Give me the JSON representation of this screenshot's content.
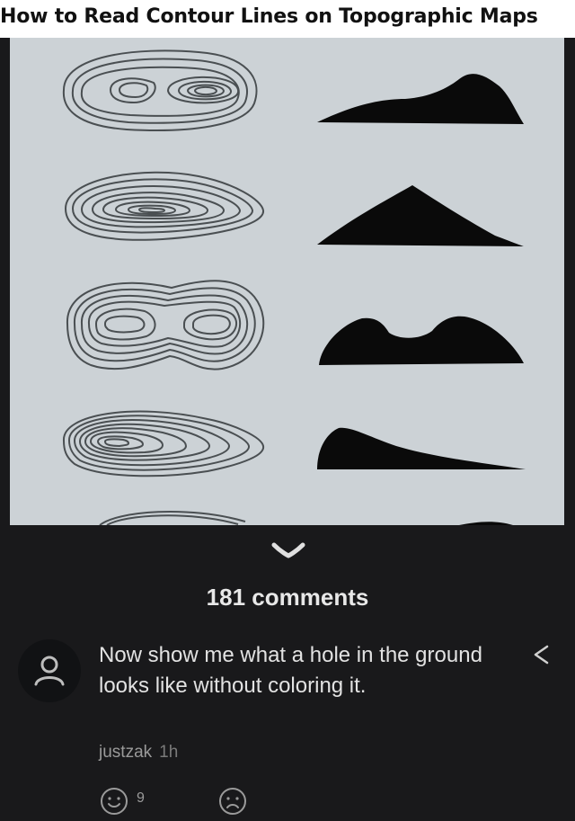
{
  "post": {
    "image_title": "How to Read Contour Lines on Topographic Maps"
  },
  "comments": {
    "count_label": "181 comments"
  },
  "comment": {
    "text": "Now show me what a hole in the ground looks like without coloring it.",
    "author": "justzak",
    "time": "1h",
    "upvote_count": "9"
  },
  "icons": {
    "collapse": "chevron-down-icon",
    "avatar": "user-icon",
    "share": "share-icon",
    "react_up": "smile-icon",
    "react_down": "frown-icon"
  },
  "colors": {
    "background": "#19191b",
    "image_background": "#ccd2d6",
    "text": "#e2e2e2",
    "muted": "#9a9a9a"
  }
}
